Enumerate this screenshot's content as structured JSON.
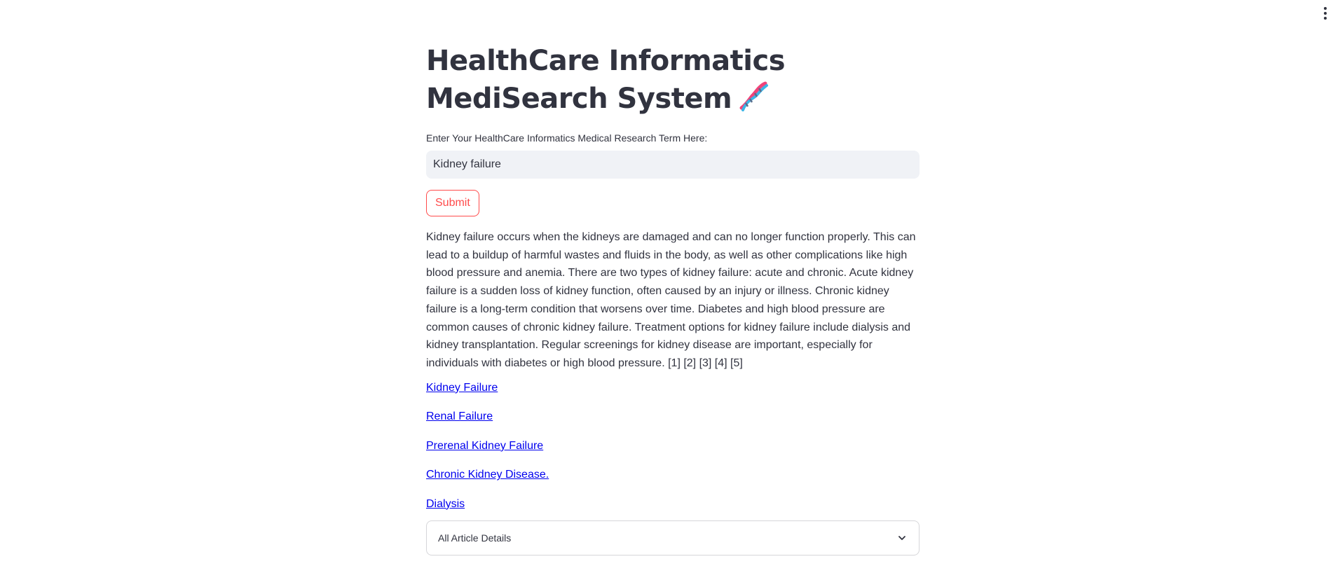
{
  "header": {
    "title": "HealthCare Informatics MediSearch System",
    "title_icon": "dna-icon"
  },
  "topbar": {
    "menu_icon": "kebab-menu-icon"
  },
  "search": {
    "label": "Enter Your HealthCare Informatics Medical Research Term Here:",
    "value": "Kidney failure",
    "placeholder": ""
  },
  "submit": {
    "label": "Submit"
  },
  "answer": {
    "text": "Kidney failure occurs when the kidneys are damaged and can no longer function properly. This can lead to a buildup of harmful wastes and fluids in the body, as well as other complications like high blood pressure and anemia. There are two types of kidney failure: acute and chronic. Acute kidney failure is a sudden loss of kidney function, often caused by an injury or illness. Chronic kidney failure is a long-term condition that worsens over time. Diabetes and high blood pressure are common causes of chronic kidney failure. Treatment options for kidney failure include dialysis and kidney transplantation. Regular screenings for kidney disease are important, especially for individuals with diabetes or high blood pressure. [1] [2] [3] [4] [5]"
  },
  "links": [
    {
      "label": "Kidney Failure"
    },
    {
      "label": "Renal Failure"
    },
    {
      "label": "Prerenal Kidney Failure"
    },
    {
      "label": "Chronic Kidney Disease."
    },
    {
      "label": "Dialysis"
    }
  ],
  "expander": {
    "label": "All Article Details",
    "icon": "chevron-down-icon"
  },
  "colors": {
    "text": "#31333f",
    "accent": "#ff4b4b",
    "input_bg": "#f0f2f6",
    "link": "#0000ee",
    "border": "#d6d6d9"
  }
}
